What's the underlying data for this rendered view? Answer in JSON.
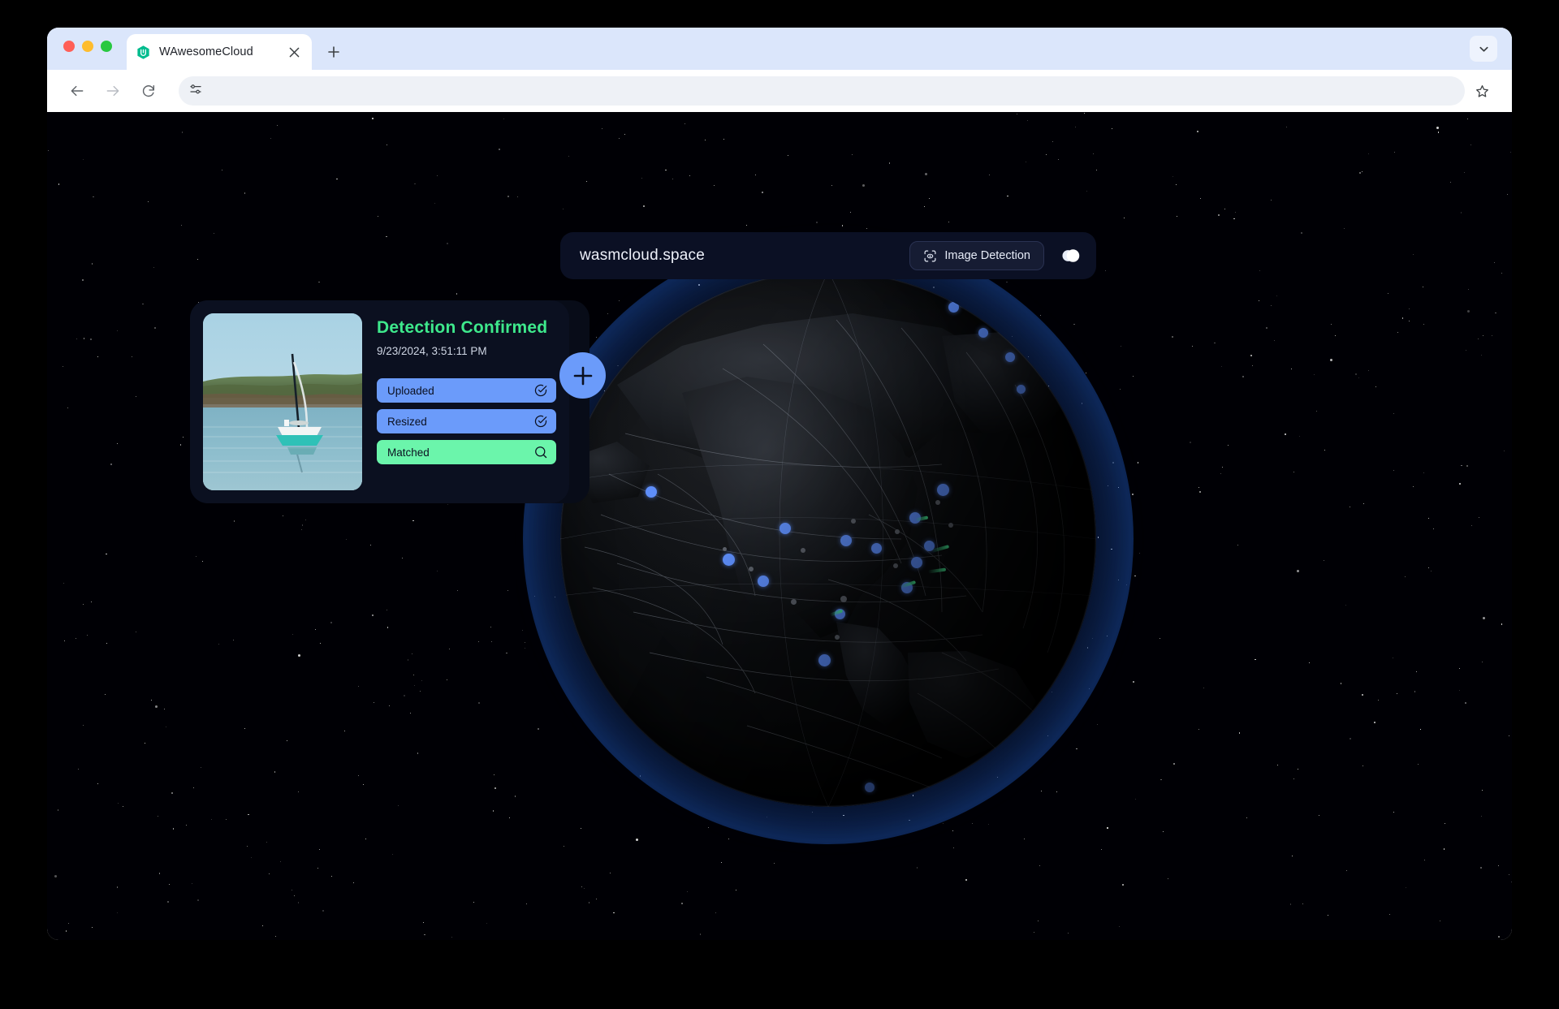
{
  "browser": {
    "tab": {
      "title": "WAwesomeCloud",
      "favicon_name": "wasmcloud-hexagon-icon",
      "close_label": "×"
    },
    "new_tab_label": "+",
    "tab_list_icon": "chevron-down-icon",
    "toolbar": {
      "back_icon": "back-arrow-icon",
      "forward_icon": "forward-arrow-icon",
      "reload_icon": "reload-icon",
      "site_settings_icon": "tune-icon",
      "bookmark_icon": "star-icon",
      "address_value": "",
      "address_placeholder": ""
    },
    "traffic_lights": {
      "close_color": "#ff5f57",
      "minimize_color": "#febc2e",
      "zoom_color": "#28c840"
    }
  },
  "page": {
    "header": {
      "site_name": "wasmcloud.space",
      "detect_button_label": "Image Detection",
      "detect_button_icon": "scan-eye-icon",
      "theme_toggle_icon": "dark-mode-contrast-icon"
    },
    "card": {
      "title": "Detection Confirmed",
      "timestamp": "9/23/2024, 3:51:11 PM",
      "thumbnail_name": "sailboat-on-lake-photo",
      "add_button_label": "+",
      "steps": [
        {
          "label": "Uploaded",
          "icon": "check-circle-icon",
          "state": "done",
          "color": "#6b9bfa"
        },
        {
          "label": "Resized",
          "icon": "check-circle-icon",
          "state": "done",
          "color": "#6b9bfa"
        },
        {
          "label": "Matched",
          "icon": "search-circle-icon",
          "state": "active",
          "color": "#6bf5ab"
        }
      ]
    },
    "globe": {
      "name": "interactive-3d-earth-globe",
      "region_in_view": "North America",
      "node_color": "#5b8cfa",
      "arc_color": "#46f096",
      "background_color": "#000005"
    }
  },
  "theme": {
    "accent_blue": "#6b9bfa",
    "accent_green": "#6bf5ab",
    "title_green": "#3ee98c",
    "card_bg": "#0b1020",
    "header_bg": "#0b1024",
    "chrome_tabstrip": "#dbe6fb"
  }
}
